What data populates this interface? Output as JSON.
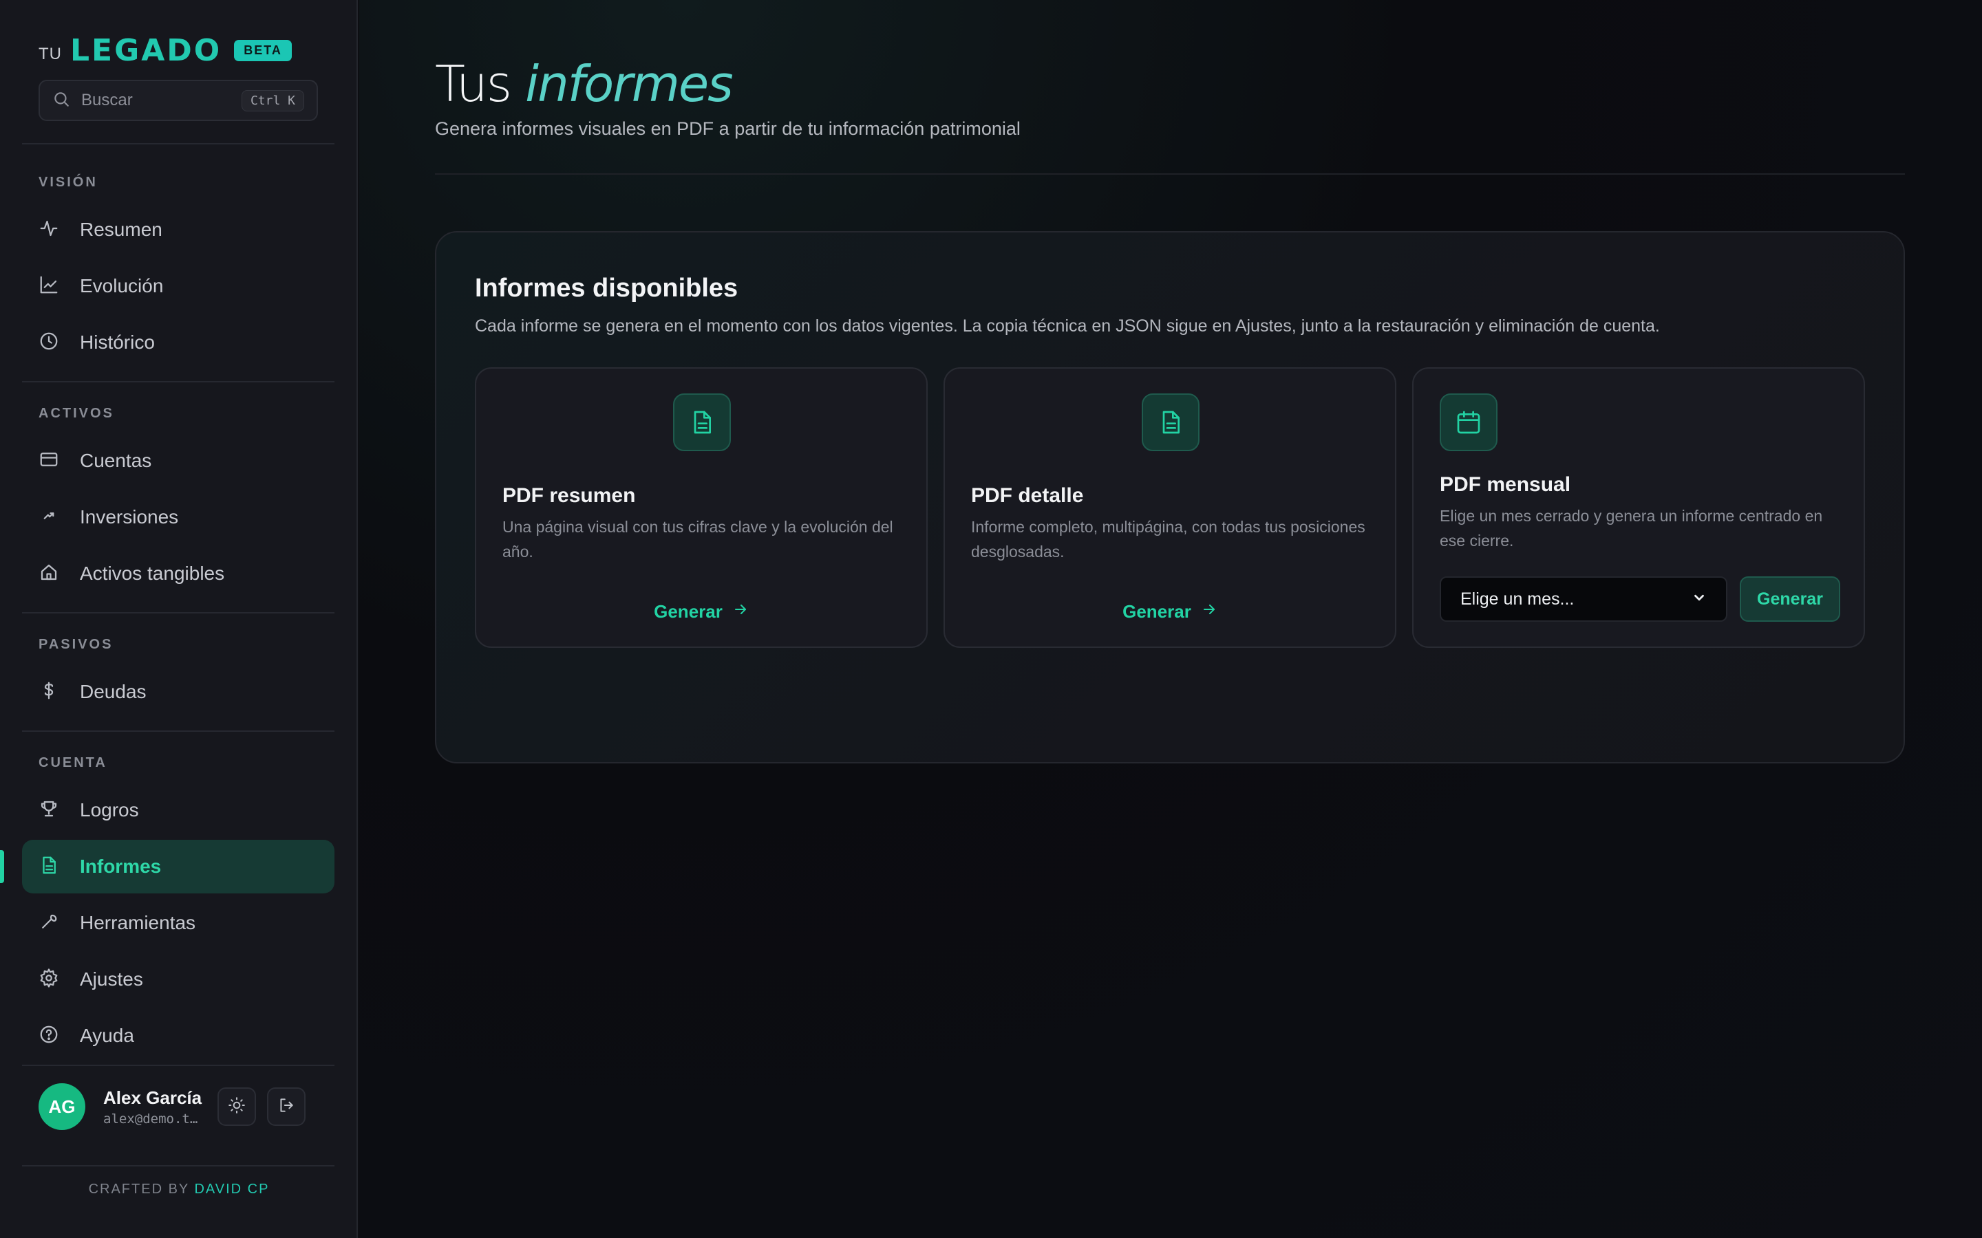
{
  "brand": {
    "prefix": "TU",
    "name": "LEGADO",
    "badge": "BETA"
  },
  "search": {
    "placeholder": "Buscar",
    "shortcut": "Ctrl K"
  },
  "sidebar": {
    "sections": [
      {
        "label": "VISIÓN",
        "items": [
          {
            "label": "Resumen",
            "icon": "activity-icon"
          },
          {
            "label": "Evolución",
            "icon": "line-chart-icon"
          },
          {
            "label": "Histórico",
            "icon": "clock-icon"
          }
        ]
      },
      {
        "label": "ACTIVOS",
        "items": [
          {
            "label": "Cuentas",
            "icon": "credit-card-icon"
          },
          {
            "label": "Inversiones",
            "icon": "trending-up-icon"
          },
          {
            "label": "Activos tangibles",
            "icon": "home-icon"
          }
        ]
      },
      {
        "label": "PASIVOS",
        "items": [
          {
            "label": "Deudas",
            "icon": "dollar-icon"
          }
        ]
      },
      {
        "label": "CUENTA",
        "items": [
          {
            "label": "Logros",
            "icon": "trophy-icon"
          },
          {
            "label": "Informes",
            "icon": "file-text-icon",
            "active": true
          },
          {
            "label": "Herramientas",
            "icon": "wrench-icon"
          },
          {
            "label": "Ajustes",
            "icon": "gear-icon"
          },
          {
            "label": "Ayuda",
            "icon": "help-circle-icon"
          }
        ]
      }
    ]
  },
  "user": {
    "initials": "AG",
    "name": "Alex García",
    "email": "alex@demo.t…"
  },
  "footer": {
    "crafted_prefix": "CRAFTED BY",
    "author": "DAVID CP"
  },
  "page": {
    "title_plain": "Tus",
    "title_accent": "informes",
    "subtitle": "Genera informes visuales en PDF a partir de tu información patrimonial"
  },
  "panel": {
    "title": "Informes disponibles",
    "description": "Cada informe se genera en el momento con los datos vigentes. La copia técnica en JSON sigue en Ajustes, junto a la restauración y eliminación de cuenta.",
    "cards": [
      {
        "title": "PDF resumen",
        "description": "Una página visual con tus cifras clave y la evolución del año.",
        "action": "Generar",
        "icon": "file-text-icon"
      },
      {
        "title": "PDF detalle",
        "description": "Informe completo, multipágina, con todas tus posiciones desglosadas.",
        "action": "Generar",
        "icon": "file-text-icon"
      },
      {
        "title": "PDF mensual",
        "description": "Elige un mes cerrado y genera un informe centrado en ese cierre.",
        "select_value": "Elige un mes...",
        "action": "Generar",
        "icon": "calendar-icon"
      }
    ]
  },
  "colors": {
    "accent": "#22d3a4",
    "brand": "#22c9b0",
    "background": "#0d0e12",
    "sidebar": "#16171d"
  }
}
